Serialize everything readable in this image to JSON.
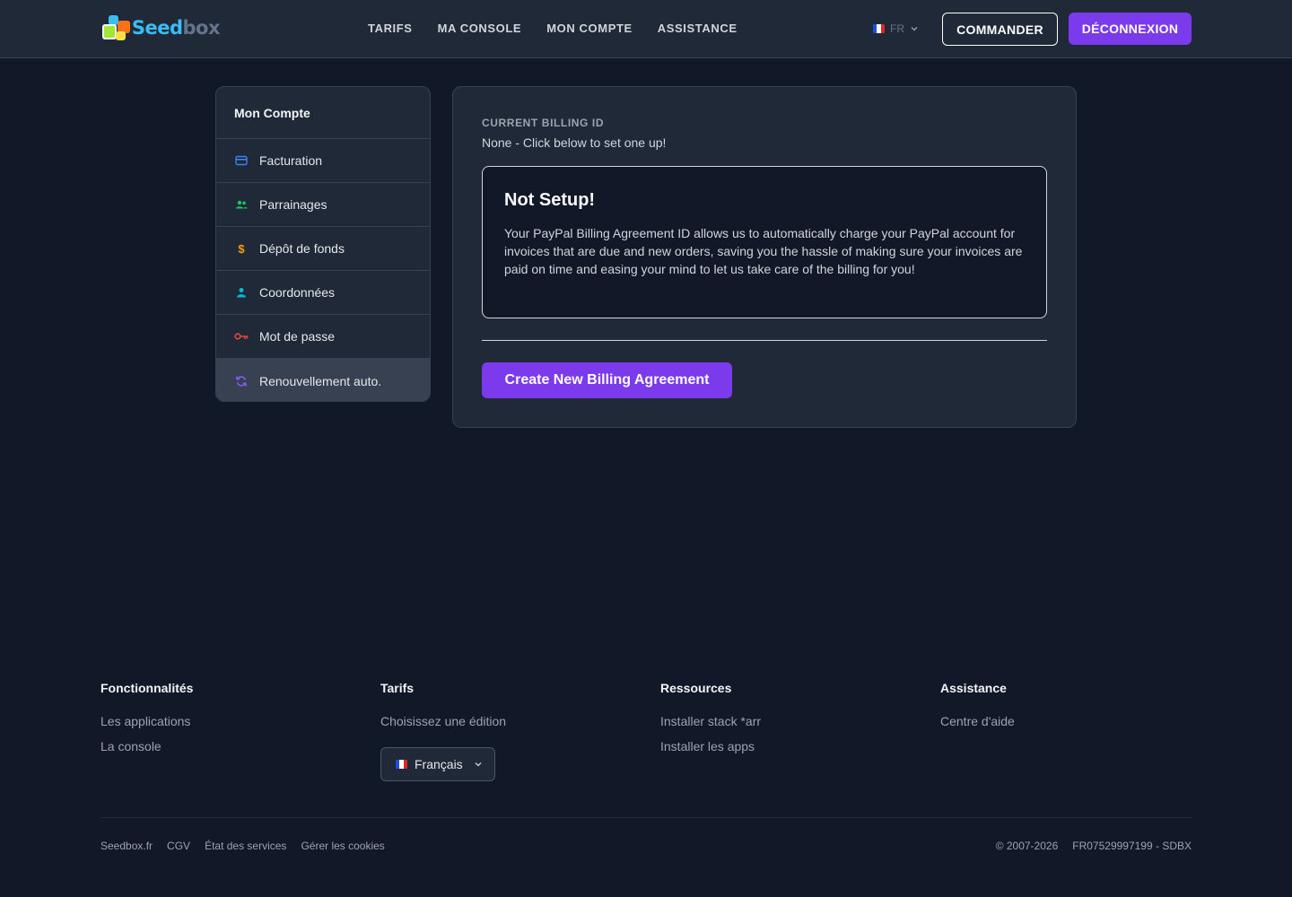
{
  "header": {
    "logo_text_a": "Seed",
    "logo_text_b": "box",
    "nav": [
      "TARIFS",
      "MA CONSOLE",
      "MON COMPTE",
      "ASSISTANCE"
    ],
    "lang": "FR",
    "order_label": "COMMANDER",
    "logout_label": "DÉCONNEXION"
  },
  "sidebar": {
    "title": "Mon Compte",
    "items": [
      {
        "label": "Facturation",
        "icon": "credit-card-icon",
        "color": "#3b82f6"
      },
      {
        "label": "Parrainages",
        "icon": "users-icon",
        "color": "#22c55e"
      },
      {
        "label": "Dépôt de fonds",
        "icon": "dollar-icon",
        "color": "#f59e0b"
      },
      {
        "label": "Coordonnées",
        "icon": "user-icon",
        "color": "#06b6d4"
      },
      {
        "label": "Mot de passe",
        "icon": "key-icon",
        "color": "#ef4444"
      },
      {
        "label": "Renouvellement auto.",
        "icon": "refresh-icon",
        "color": "#8b5cf6",
        "active": true
      }
    ]
  },
  "main": {
    "billing_label": "CURRENT BILLING ID",
    "billing_value": "None - Click below to set one up!",
    "notice_title": "Not Setup!",
    "notice_text": "Your PayPal Billing Agreement ID allows us to automatically charge your PayPal account for invoices that are due and new orders, saving you the hassle of making sure your invoices are paid on time and easing your mind to let us take care of the billing for you!",
    "create_button": "Create New Billing Agreement"
  },
  "footer": {
    "columns": [
      {
        "title": "Fonctionnalités",
        "links": [
          "Les applications",
          "La console"
        ]
      },
      {
        "title": "Tarifs",
        "links": [
          "Choisissez une édition"
        ]
      },
      {
        "title": "Ressources",
        "links": [
          "Installer stack *arr",
          "Installer les apps"
        ]
      },
      {
        "title": "Assistance",
        "links": [
          "Centre d'aide"
        ]
      }
    ],
    "language_select": "Français",
    "bottom_links": [
      "Seedbox.fr",
      "CGV",
      "État des services",
      "Gérer les cookies"
    ],
    "copyright": "© 2007-2026",
    "company_id": "FR07529997199 - SDBX"
  },
  "colors": {
    "accent": "#7c3aed",
    "background": "#111827",
    "surface": "#1f2937"
  }
}
